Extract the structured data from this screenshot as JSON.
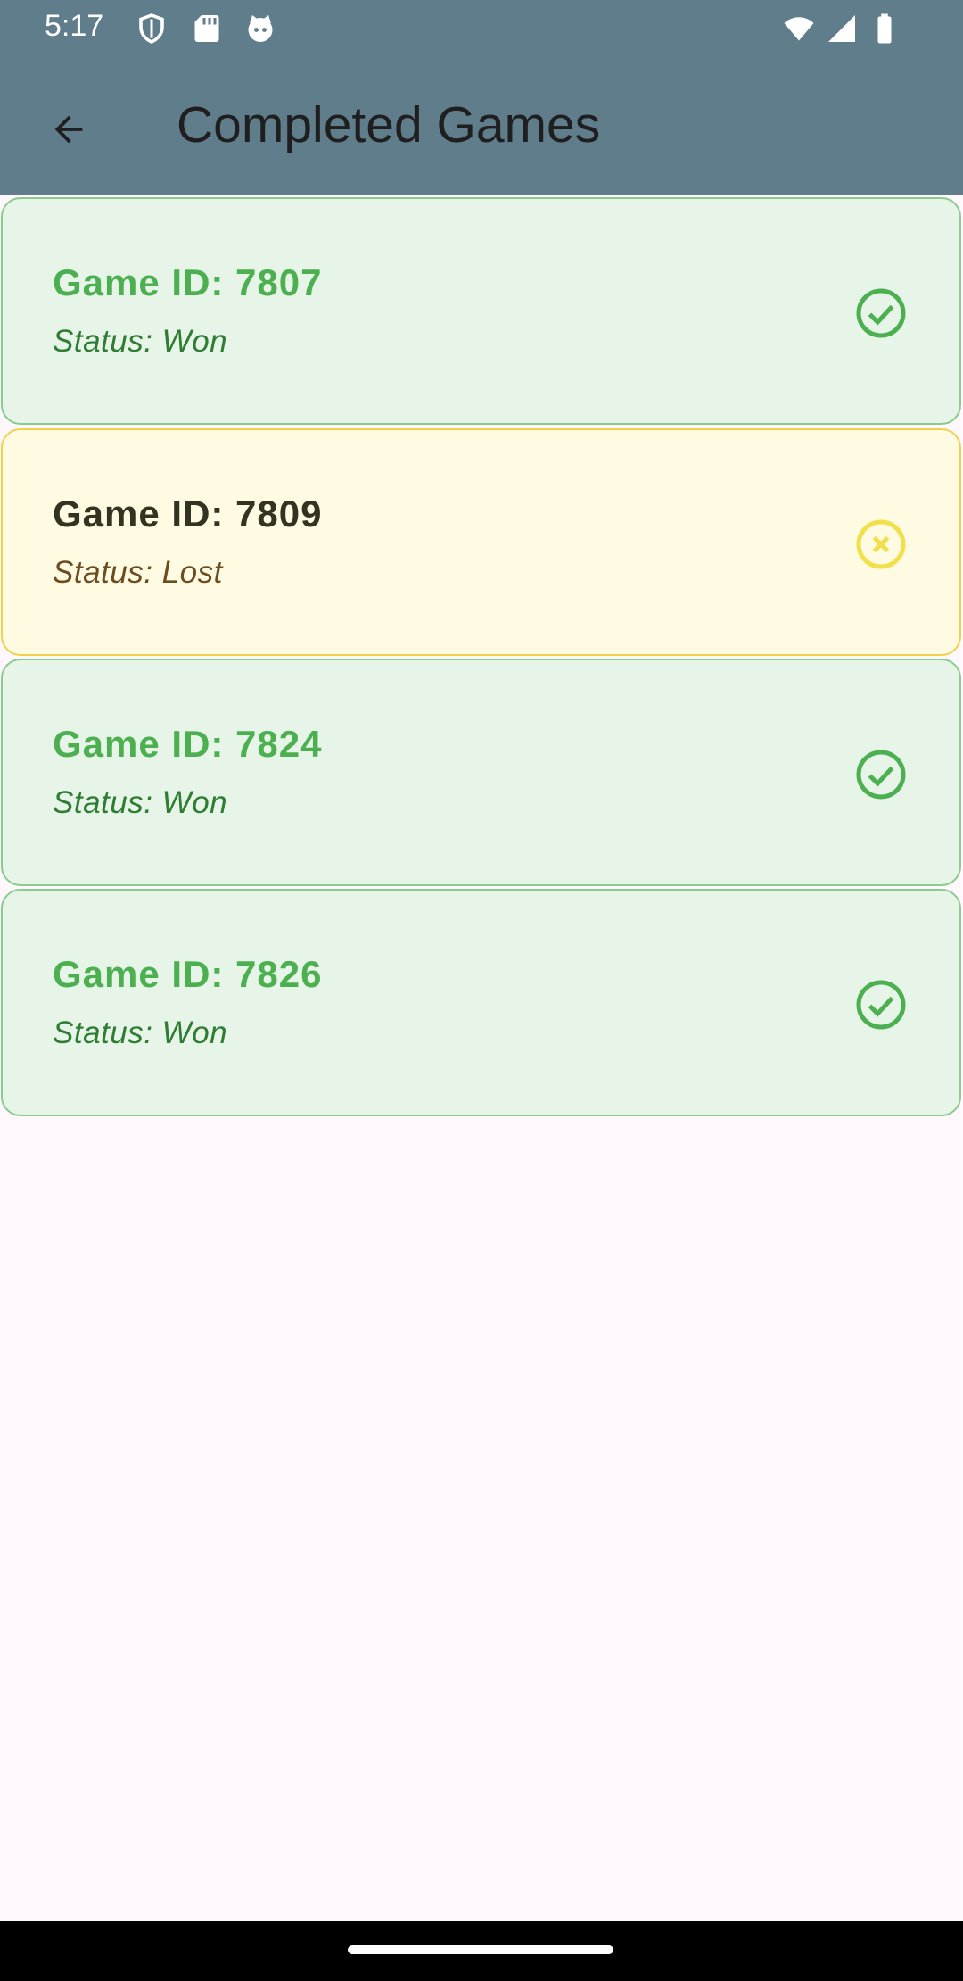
{
  "status_bar": {
    "time": "5:17",
    "left_icons": [
      "shield-icon",
      "sd-card-icon",
      "cat-face-icon"
    ],
    "right_icons": [
      "wifi-icon",
      "signal-icon",
      "battery-icon"
    ]
  },
  "app_bar": {
    "title": "Completed Games",
    "back_icon": "arrow-back-icon",
    "color": "#607d8b"
  },
  "games": [
    {
      "title": "Game ID: 7807",
      "status": "Status: Won",
      "result": "won",
      "icon": "check-circle-icon"
    },
    {
      "title": "Game ID: 7809",
      "status": "Status: Lost",
      "result": "lost",
      "icon": "x-circle-icon"
    },
    {
      "title": "Game ID: 7824",
      "status": "Status: Won",
      "result": "won",
      "icon": "check-circle-icon"
    },
    {
      "title": "Game ID: 7826",
      "status": "Status: Won",
      "result": "won",
      "icon": "check-circle-icon"
    }
  ],
  "colors": {
    "won_bg": "#e7f5e9",
    "won_accent": "#4caf50",
    "lost_bg": "#fffbe3",
    "lost_accent": "#f2e04a",
    "page_bg": "#fef7fb"
  }
}
